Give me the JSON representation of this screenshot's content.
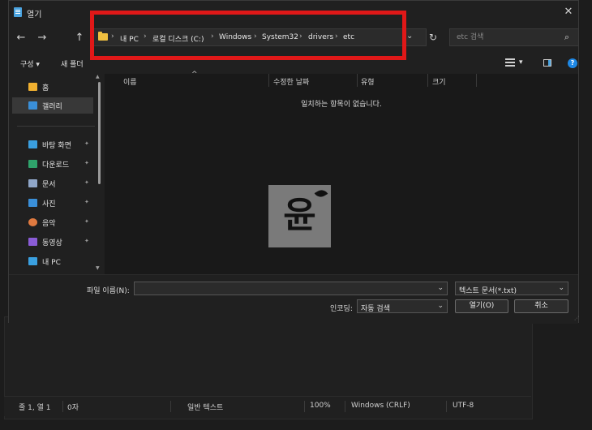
{
  "dialog": {
    "title": "열기",
    "close_glyph": "✕"
  },
  "nav": {
    "back": "←",
    "forward": "→",
    "up": "↑"
  },
  "address": {
    "crumbs": [
      "내 PC",
      "로컬 디스크 (C:)",
      "Windows",
      "System32",
      "drivers",
      "etc"
    ],
    "sep": "›",
    "dropdown": "⌄",
    "refresh": "↻"
  },
  "search": {
    "placeholder": "etc 검색",
    "icon": "⌕"
  },
  "toolbar": {
    "organize": "구성 ▾",
    "new_folder": "새 폴더",
    "view_dd": "▾",
    "help": "?"
  },
  "sidebar": {
    "items": [
      {
        "label": "홈",
        "icon": "home-icon",
        "color": "#f0b030"
      },
      {
        "label": "갤러리",
        "icon": "gallery-icon",
        "color": "#3a8fd8"
      },
      {
        "label": "바탕 화면",
        "icon": "desktop-icon",
        "color": "#3a9fe0"
      },
      {
        "label": "다운로드",
        "icon": "download-icon",
        "color": "#2fa36b"
      },
      {
        "label": "문서",
        "icon": "document-icon",
        "color": "#8fa6c8"
      },
      {
        "label": "사진",
        "icon": "pictures-icon",
        "color": "#3a8fd8"
      },
      {
        "label": "음악",
        "icon": "music-icon",
        "color": "#e07a40"
      },
      {
        "label": "동영상",
        "icon": "video-icon",
        "color": "#8a5cd6"
      },
      {
        "label": "내 PC",
        "icon": "pc-icon",
        "color": "#3aa0e0"
      }
    ],
    "pin_glyph": "📌"
  },
  "columns": {
    "name": "이름",
    "modified": "수정한 날짜",
    "type": "유형",
    "size": "크기",
    "sort_caret": "^"
  },
  "empty_message": "일치하는 항목이 없습니다.",
  "watermark": {
    "char": "윤"
  },
  "bottom": {
    "filename_label": "파일 이름(N):",
    "filename_value": "",
    "filetype_value": "텍스트 문서(*.txt)",
    "encoding_label": "인코딩:",
    "encoding_value": "자동 검색",
    "open_button": "열기(O)",
    "cancel_button": "취소",
    "dropdown": "⌄"
  },
  "statusbar": {
    "position": "줄 1, 열 1",
    "chars": "0자",
    "format": "일반 텍스트",
    "zoom": "100%",
    "eol": "Windows (CRLF)",
    "encoding": "UTF-8"
  }
}
